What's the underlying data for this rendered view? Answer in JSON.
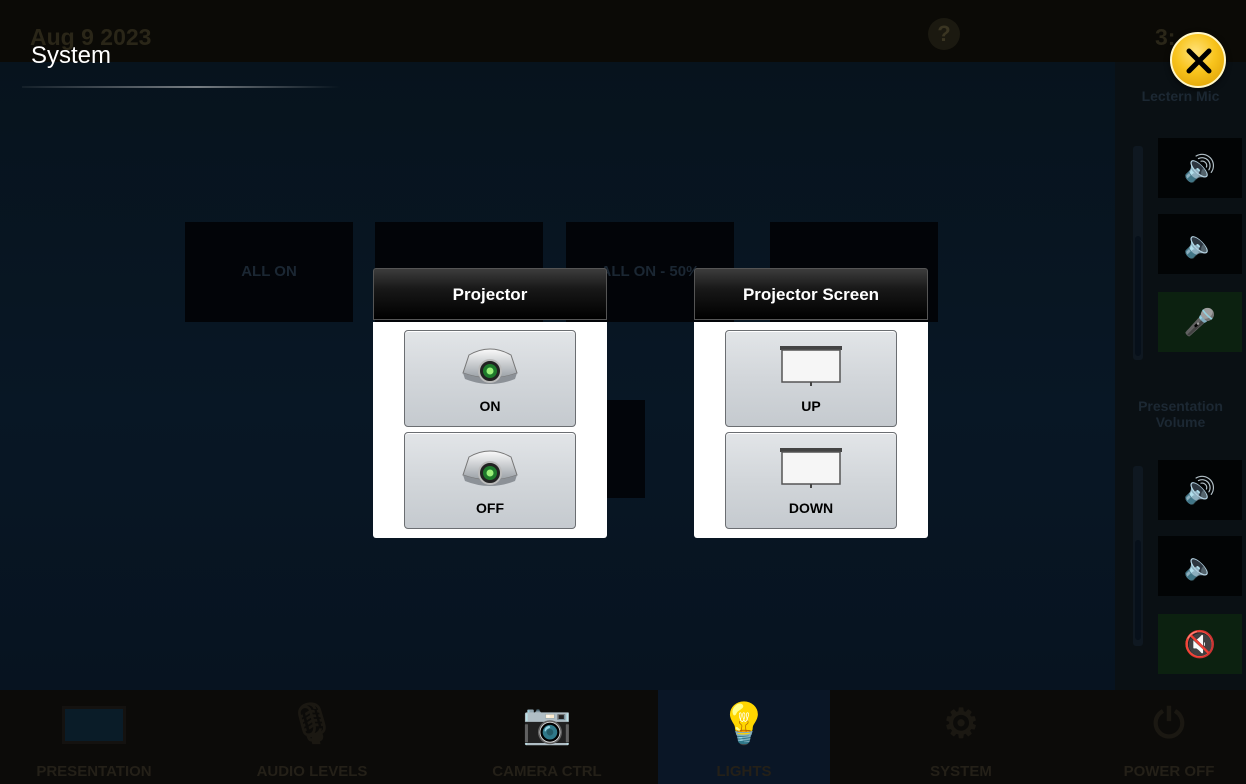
{
  "background": {
    "date": "Aug 9 2023",
    "help_symbol": "?",
    "clock": "3:",
    "lighting_buttons": [
      "ALL ON",
      "",
      "ALL ON - 50%",
      ""
    ],
    "side_panel": {
      "lectern_mic_label": "Lectern Mic",
      "presentation_volume_label": "Presentation Volume"
    },
    "bottom_nav": [
      {
        "label": "PRESENTATION",
        "icon": "monitor-icon"
      },
      {
        "label": "AUDIO LEVELS",
        "icon": "microphone-icon"
      },
      {
        "label": "CAMERA CTRL",
        "icon": "camera-icon"
      },
      {
        "label": "LIGHTS",
        "icon": "lightbulb-icon",
        "active": true
      },
      {
        "label": "SYSTEM",
        "icon": "gear-icon"
      },
      {
        "label": "POWER OFF",
        "icon": "power-icon"
      }
    ]
  },
  "overlay": {
    "title": "System",
    "close_icon": "close-icon",
    "projector": {
      "header": "Projector",
      "buttons": [
        {
          "label": "ON",
          "icon": "projector-icon"
        },
        {
          "label": "OFF",
          "icon": "projector-icon"
        }
      ]
    },
    "projector_screen": {
      "header": "Projector Screen",
      "buttons": [
        {
          "label": "UP",
          "icon": "projection-screen-icon"
        },
        {
          "label": "DOWN",
          "icon": "projection-screen-icon"
        }
      ]
    }
  },
  "colors": {
    "close_button": "#f8c41d",
    "panel_body": "#ffffff",
    "button_face": "#d2d6da",
    "header_bg": "#000000"
  }
}
